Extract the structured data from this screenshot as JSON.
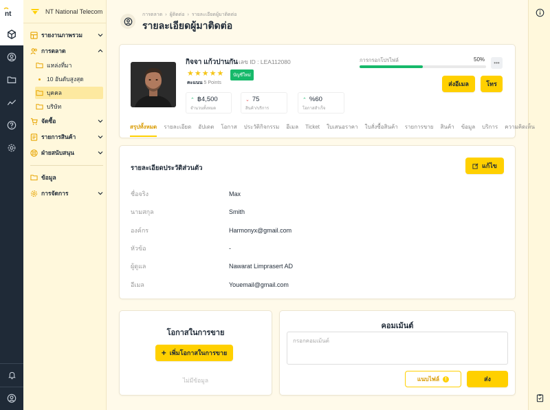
{
  "app": {
    "logo_text": "nt",
    "name": "NT National Telecom"
  },
  "sidebar": {
    "groups": [
      {
        "label": "รายงานภาพรวม",
        "expanded": false
      },
      {
        "label": "การตลาด",
        "expanded": true
      },
      {
        "label": "จัดซื้อ",
        "expanded": false
      },
      {
        "label": "รายการสินค้า",
        "expanded": false
      },
      {
        "label": "ฝ่ายสนับสนุน",
        "expanded": false
      }
    ],
    "sub_items": [
      {
        "label": "แหล่งที่มา",
        "active": false
      },
      {
        "label": "10 อันดับสูงสุด",
        "active": false
      },
      {
        "label": "บุคคล",
        "active": true
      },
      {
        "label": "บริษัท",
        "active": false
      }
    ],
    "bottom": [
      {
        "label": "ข้อมูล"
      },
      {
        "label": "การจัดการ"
      }
    ]
  },
  "breadcrumb": [
    "การตลาด",
    "ผู้ติดต่อ",
    "รายละเอียดผู้มาติดต่อ"
  ],
  "page_title": "รายละเอียดผู้มาติดต่อ",
  "profile": {
    "name": "กิจจา แก้วปานกัน",
    "id_label": "เลข ID : LEA112080",
    "stars": "★★★★★",
    "score_label": "คะแนน",
    "score_value": "5 Points",
    "badge": "บัญชีใหม่",
    "stats": [
      {
        "value": "฿4,500",
        "label": "จำนวนทั้งหมด",
        "trend": "up"
      },
      {
        "value": "75",
        "label": "สินค้า/บริการ",
        "trend": "down"
      },
      {
        "value": "%60",
        "label": "โอกาสสำเร็จ",
        "trend": "up"
      }
    ],
    "progress_label": "การกรอกโปรไฟล์",
    "progress_text": "50%",
    "progress_value": 0.5,
    "email_button": "ส่งอีเมล",
    "call_button": "โทร"
  },
  "tabs": [
    "สรุปทั้งหมด",
    "รายละเอียด",
    "อัปเดต",
    "โอกาส",
    "ประวัติกิจกรรม",
    "อีเมล",
    "Ticket",
    "ใบเสนอราคา",
    "ใบสั่งซื้อสินค้า",
    "รายการขาย",
    "สินค้า",
    "ข้อมูล",
    "บริการ",
    "ความคิดเห็น"
  ],
  "details": {
    "title": "รายละเอียดประวัติส่วนตัว",
    "edit_button": "แก้ไข",
    "rows": [
      {
        "key": "ชื่อจริง",
        "value": "Max"
      },
      {
        "key": "นามสกุล",
        "value": "Smith"
      },
      {
        "key": "องค์กร",
        "value": "Harmonyx@gmail.com"
      },
      {
        "key": "หัวข้อ",
        "value": "-"
      },
      {
        "key": "ผู้ดูแล",
        "value": "Nawarat Limprasert AD"
      },
      {
        "key": "อีเมล",
        "value": "Youemail@gmail.com"
      }
    ]
  },
  "opportunities": {
    "title": "โอกาสในการขาย",
    "add_button": "เพิ่มโอกาสในการขาย",
    "empty": "ไม่มีข้อมูล"
  },
  "comments": {
    "title": "คอมเม้นต์",
    "placeholder": "กรอกคอมเม้นต์",
    "attach_button": "แนบไฟล์",
    "send_button": "ส่ง"
  },
  "colors": {
    "accent": "#ffd000",
    "success": "#16b96a",
    "rail": "#1f2a37"
  }
}
